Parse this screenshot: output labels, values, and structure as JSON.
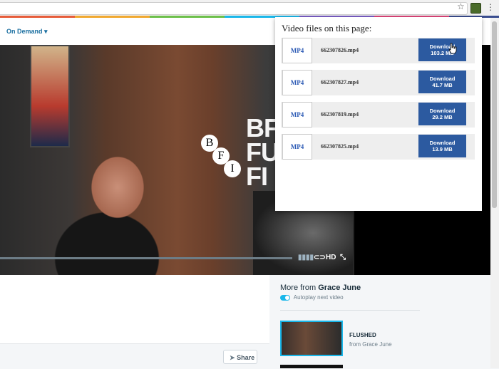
{
  "nav": {
    "on_demand": "On Demand ▾"
  },
  "video": {
    "bfi_text": [
      "BFI",
      "FU",
      "FI"
    ],
    "bfi_logo": [
      "B",
      "F",
      "I"
    ],
    "hd_label": "HD"
  },
  "popup": {
    "title": "Video files on this page:",
    "files": [
      {
        "format": "MP4",
        "name": "662307826.mp4",
        "download_label": "Download",
        "size": "103.2 MB"
      },
      {
        "format": "MP4",
        "name": "662307827.mp4",
        "download_label": "Download",
        "size": "41.7 MB"
      },
      {
        "format": "MP4",
        "name": "662307819.mp4",
        "download_label": "Download",
        "size": "29.2 MB"
      },
      {
        "format": "MP4",
        "name": "662307825.mp4",
        "download_label": "Download",
        "size": "13.9 MB"
      }
    ]
  },
  "sidebar": {
    "more_from_prefix": "More from",
    "more_from_name": "Grace June",
    "autoplay": "Autoplay next video",
    "items": [
      {
        "title": "FLUSHED",
        "subtitle": "from Grace June"
      }
    ]
  },
  "share": {
    "label": "Share"
  },
  "colors": {
    "accent": "#1ab7ea",
    "download_button": "#2c5aa0",
    "link": "#1a6fa0"
  }
}
